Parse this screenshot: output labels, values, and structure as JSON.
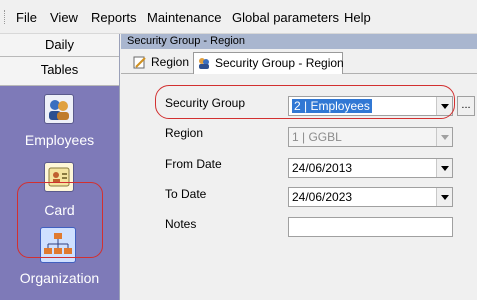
{
  "menu": {
    "items": [
      "File",
      "View",
      "Reports",
      "Maintenance",
      "Global parameters",
      "Help"
    ]
  },
  "nav": {
    "daily_label": "Daily",
    "tables_label": "Tables",
    "tiles": [
      {
        "label": "Employees",
        "icon": "employees-icon"
      },
      {
        "label": "Card",
        "icon": "card-icon"
      },
      {
        "label": "Organization",
        "icon": "organization-icon"
      }
    ],
    "panel_color": "#7e7ab8"
  },
  "window": {
    "title": "Security Group  - Region"
  },
  "tabs": [
    {
      "label": "Region",
      "icon": "edit-icon"
    },
    {
      "label": "Security Group  - Region",
      "icon": "security-group-icon"
    }
  ],
  "form": {
    "security_group": {
      "label": "Security Group",
      "value": "2  |  Employees"
    },
    "region": {
      "label": "Region",
      "value": "1  |  GGBL"
    },
    "from_date": {
      "label": "From Date",
      "value": "24/06/2013"
    },
    "to_date": {
      "label": "To Date",
      "value": "24/06/2023"
    },
    "notes": {
      "label": "Notes",
      "value": ""
    },
    "ellipsis_label": "..."
  },
  "colors": {
    "highlight": "#d23030",
    "selection": "#3178d4",
    "title_strip": "#a9b6cf"
  }
}
